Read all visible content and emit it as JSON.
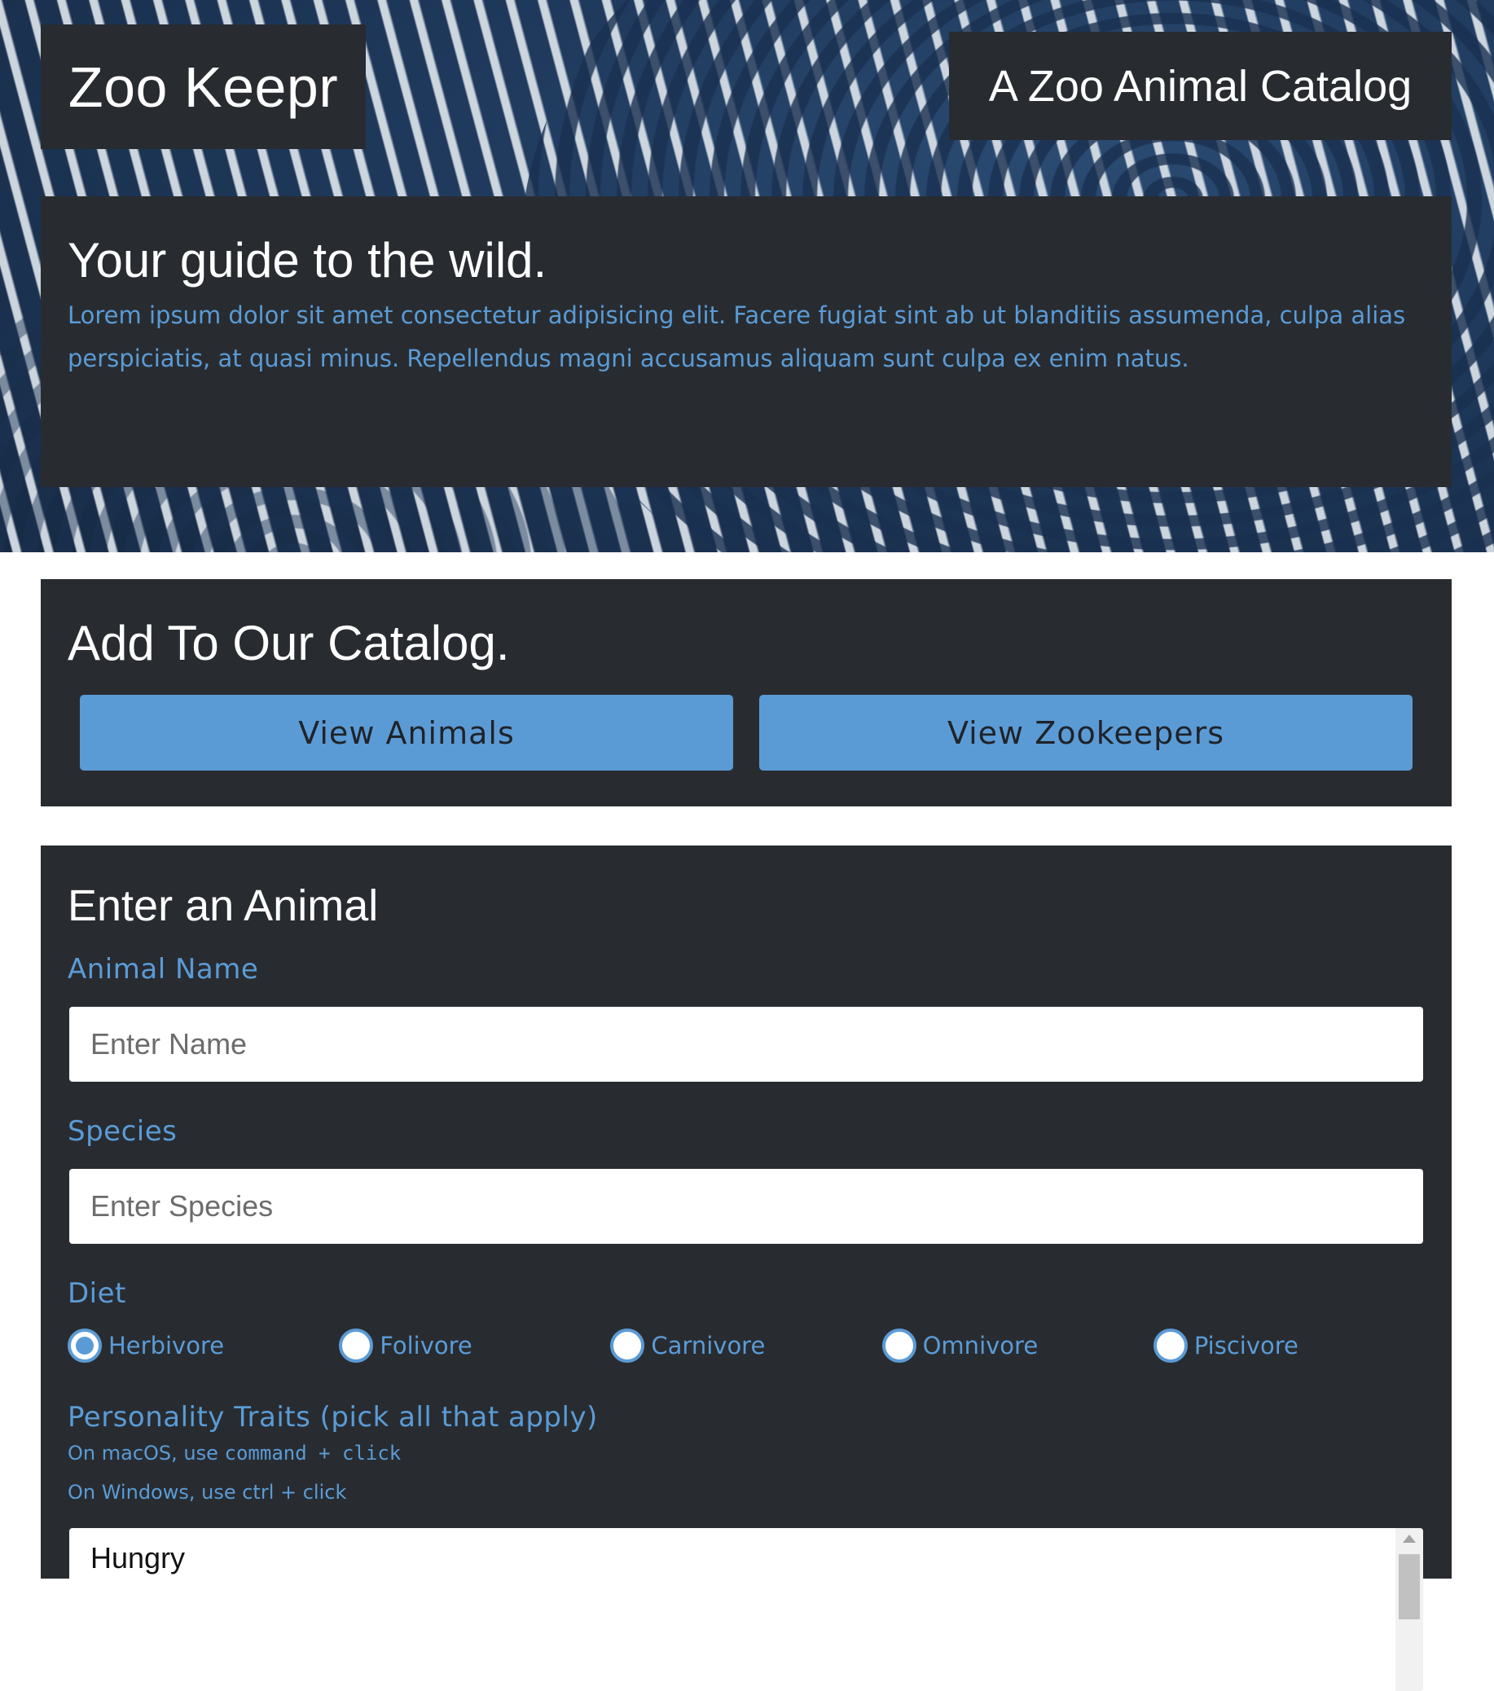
{
  "header": {
    "logo": "Zoo Keepr",
    "tagline": "A Zoo Animal Catalog"
  },
  "intro": {
    "title": "Your guide to the wild.",
    "body": "Lorem ipsum dolor sit amet consectetur adipisicing elit. Facere fugiat sint ab ut blanditiis assumenda, culpa alias perspiciatis, at quasi minus. Repellendus magni accusamus aliquam sunt culpa ex enim natus."
  },
  "catalog": {
    "title": "Add To Our Catalog.",
    "view_animals": "View Animals",
    "view_zookeepers": "View Zookeepers"
  },
  "form": {
    "title": "Enter an Animal",
    "name_label": "Animal Name",
    "name_placeholder": "Enter Name",
    "species_label": "Species",
    "species_placeholder": "Enter Species",
    "diet_label": "Diet",
    "diet_options": [
      {
        "label": "Herbivore",
        "checked": true
      },
      {
        "label": "Folivore",
        "checked": false
      },
      {
        "label": "Carnivore",
        "checked": false
      },
      {
        "label": "Omnivore",
        "checked": false
      },
      {
        "label": "Piscivore",
        "checked": false
      }
    ],
    "traits_label": "Personality Traits (pick all that apply)",
    "hint_mac_prefix": "On macOS, use",
    "hint_mac_keys": "command + click",
    "hint_windows": "On Windows, use ctrl + click",
    "traits_first_option": "Hungry"
  },
  "colors": {
    "panel": "#282c31",
    "accent": "#5b9bd5",
    "hero_blue": "#1f3a5d"
  }
}
